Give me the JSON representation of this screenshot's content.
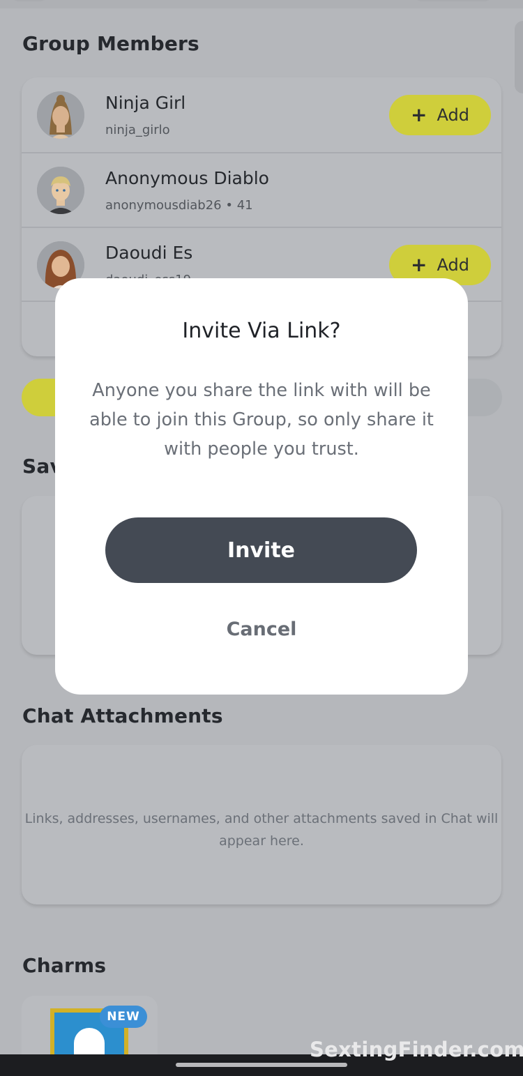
{
  "colors": {
    "backdrop": "#b5b7bb",
    "add_button": "#cfce3b",
    "invite_button": "#444a54",
    "modal": "#ffffff",
    "new_badge": "#3b8fd6"
  },
  "sections": {
    "group_members_title": "Group Members",
    "saved_title_visible": "Sav",
    "chat_attachments_title": "Chat Attachments",
    "charms_title": "Charms"
  },
  "members": [
    {
      "name": "Ninja Girl",
      "sub": "ninja_girlo",
      "add_label": "Add",
      "avatar_icon": "bitmoji-avatar"
    },
    {
      "name": "Anonymous Diablo",
      "sub": "anonymousdiab26 • 41",
      "avatar_icon": "bitmoji-avatar"
    },
    {
      "name": "Daoudi Es",
      "sub": "daoudi_ess19",
      "add_label": "Add",
      "avatar_icon": "bitmoji-avatar"
    }
  ],
  "chat_attachments": {
    "empty_text": "Links, addresses, usernames, and other attachments saved in Chat will appear here."
  },
  "charms": {
    "new_badge": "NEW",
    "charm_icon": "ghost-icon"
  },
  "modal": {
    "title": "Invite Via Link?",
    "body": "Anyone you share the link with will be able to join this Group, so only share it with people you trust.",
    "invite_label": "Invite",
    "cancel_label": "Cancel"
  },
  "watermark": "SextingFinder.com"
}
